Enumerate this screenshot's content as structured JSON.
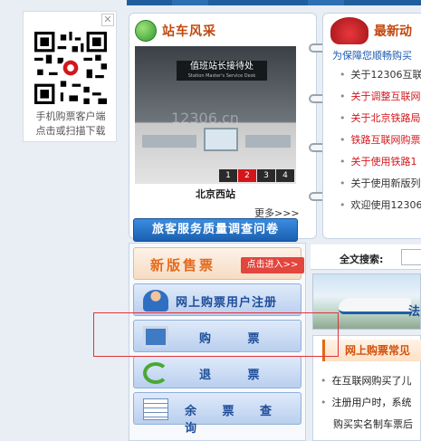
{
  "qr": {
    "close": "✕",
    "caption_line1": "手机购票客户端",
    "caption_line2": "点击或扫描下载"
  },
  "station": {
    "title": "站车风采",
    "sign_main": "值班站长接待处",
    "sign_sub": "Station Master's Service Desk",
    "watermark": "12306.cn",
    "pager": [
      "1",
      "2",
      "3",
      "4"
    ],
    "pager_active": "2",
    "caption": "北京西站",
    "more": "更多>>>",
    "survey": "旅客服务质量调查问卷"
  },
  "news": {
    "title": "最新动",
    "lead": "为保障您顺畅购买",
    "items": [
      {
        "text": "关于12306互联",
        "color": "#333333"
      },
      {
        "text": "关于调整互联网",
        "color": "#d4161b"
      },
      {
        "text": "关于北京铁路局",
        "color": "#d4161b"
      },
      {
        "text": "铁路互联网购票",
        "color": "#d4161b"
      },
      {
        "text": "关于使用铁路1",
        "color": "#d4161b"
      },
      {
        "text": "关于使用新版列",
        "color": "#333333"
      },
      {
        "text": "欢迎使用12306",
        "color": "#333333"
      }
    ]
  },
  "menu": {
    "new_sale": "新版售票",
    "new_sale_btn": "点击进入>>",
    "register": "网上购票用户注册",
    "buy": "购 票",
    "refund": "退 票",
    "remaining": "余 票 查 询"
  },
  "search": {
    "label": "全文搜索:"
  },
  "banner": {
    "text": "法"
  },
  "faq": {
    "title": "网上购票常见",
    "items": [
      {
        "text": "在互联网购买了儿",
        "bullet": true
      },
      {
        "text": "注册用户时，系统",
        "bullet": true
      },
      {
        "text": "购买实名制车票后",
        "bullet": false
      }
    ]
  }
}
